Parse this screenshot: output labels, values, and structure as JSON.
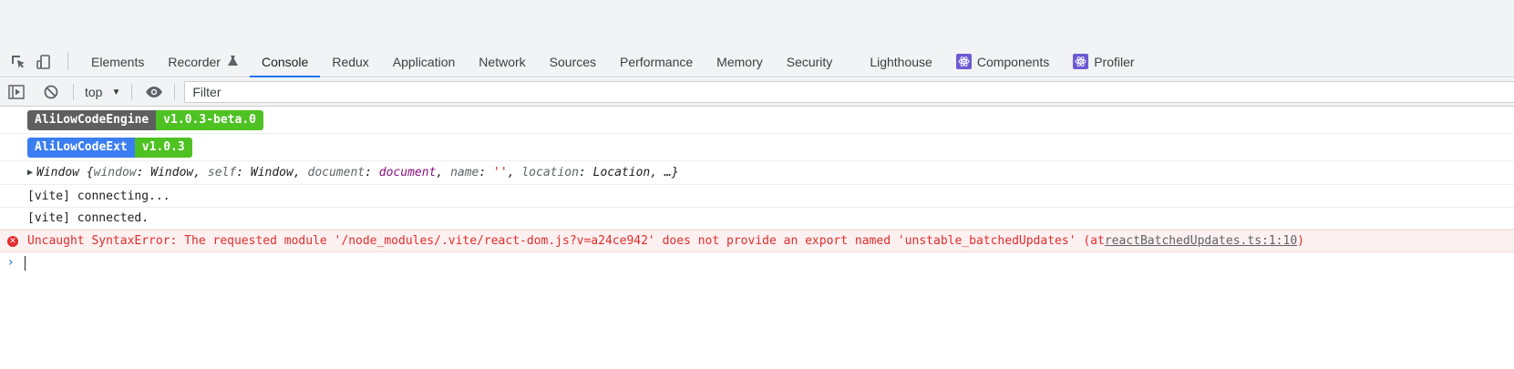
{
  "tabs": [
    {
      "label": "Elements",
      "active": false
    },
    {
      "label": "Recorder",
      "active": false,
      "experiment": true
    },
    {
      "label": "Console",
      "active": true
    },
    {
      "label": "Redux",
      "active": false
    },
    {
      "label": "Application",
      "active": false
    },
    {
      "label": "Network",
      "active": false
    },
    {
      "label": "Sources",
      "active": false
    },
    {
      "label": "Performance",
      "active": false
    },
    {
      "label": "Memory",
      "active": false
    },
    {
      "label": "Security",
      "active": false
    },
    {
      "label": "Lighthouse",
      "active": false
    },
    {
      "label": "Components",
      "active": false,
      "react": true
    },
    {
      "label": "Profiler",
      "active": false,
      "react": true
    }
  ],
  "toolbar": {
    "context": "top",
    "filter_placeholder": "Filter"
  },
  "console": {
    "engine_badge": {
      "name": "AliLowCodeEngine",
      "version": "v1.0.3-beta.0",
      "name_color": "#5f5f5f"
    },
    "ext_badge": {
      "name": "AliLowCodeExt",
      "version": "v1.0.3",
      "name_color": "#3a7ef2"
    },
    "window_obj": {
      "head": "Window {",
      "k1": "window",
      "v1": "Window",
      "k2": "self",
      "v2": "Window",
      "k3": "document",
      "v3": "document",
      "k4": "name",
      "v4": "''",
      "k5": "location",
      "v5": "Location",
      "tail": ", …}"
    },
    "log1": "[vite] connecting...",
    "log2": "[vite] connected.",
    "error": {
      "text": "Uncaught SyntaxError: The requested module '/node_modules/.vite/react-dom.js?v=a24ce942' does not provide an export named 'unstable_batchedUpdates' (at ",
      "link": "reactBatchedUpdates.ts:1:10",
      "tail": ")"
    }
  }
}
